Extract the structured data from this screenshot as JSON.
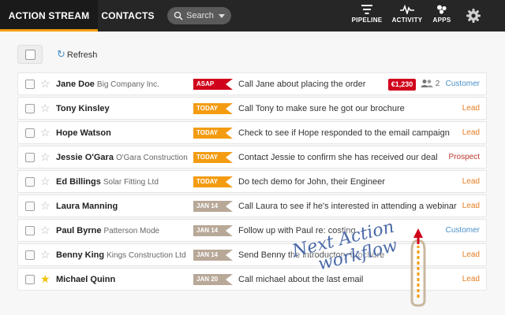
{
  "nav": {
    "tabs": [
      {
        "label": "ACTION STREAM",
        "active": true
      },
      {
        "label": "CONTACTS",
        "active": false
      }
    ],
    "search_placeholder": "Search",
    "buttons": [
      {
        "label": "PIPELINE",
        "icon": "pipeline-icon"
      },
      {
        "label": "ACTIVITY",
        "icon": "activity-icon"
      },
      {
        "label": "APPS",
        "icon": "apps-icon"
      }
    ],
    "settings_icon": "gear-icon"
  },
  "toolbar": {
    "refresh_label": "Refresh"
  },
  "colors": {
    "accent": "#f39c12",
    "asap": "#d0021b",
    "date_tag": "#b8a898",
    "customer": "#4a90c8",
    "lead": "#e67e22",
    "prospect": "#c0392b"
  },
  "rows": [
    {
      "name": "Jane Doe",
      "company": "Big Company Inc.",
      "tag": "ASAP",
      "tag_type": "asap",
      "task": "Call Jane about placing the order",
      "amount": "€1,230",
      "people": "2",
      "status": "Customer",
      "status_type": "customer",
      "starred": false
    },
    {
      "name": "Tony Kinsley",
      "company": "",
      "tag": "TODAY",
      "tag_type": "today",
      "task": "Call Tony to make sure he got our brochure",
      "status": "Lead",
      "status_type": "lead",
      "starred": false
    },
    {
      "name": "Hope Watson",
      "company": "",
      "tag": "TODAY",
      "tag_type": "today",
      "task": "Check to see if Hope responded to the email campaign",
      "status": "Lead",
      "status_type": "lead",
      "starred": false
    },
    {
      "name": "Jessie O'Gara",
      "company": "O'Gara Construction",
      "tag": "TODAY",
      "tag_type": "today",
      "task": "Contact Jessie to confirm she has received our deal",
      "status": "Prospect",
      "status_type": "prospect",
      "starred": false
    },
    {
      "name": "Ed Billings",
      "company": "Solar Fitting Ltd",
      "tag": "TODAY",
      "tag_type": "today",
      "task": "Do tech demo for John, their Engineer",
      "status": "Lead",
      "status_type": "lead",
      "starred": false
    },
    {
      "name": "Laura Manning",
      "company": "",
      "tag": "JAN 14",
      "tag_type": "date",
      "task": "Call Laura to see if he's interested in attending a webinar",
      "status": "Lead",
      "status_type": "lead",
      "starred": false
    },
    {
      "name": "Paul Byrne",
      "company": "Patterson Mode",
      "tag": "JAN 14",
      "tag_type": "date",
      "task": "Follow up with Paul re: costing",
      "status": "Customer",
      "status_type": "customer",
      "starred": false
    },
    {
      "name": "Benny King",
      "company": "Kings Construction Ltd",
      "tag": "JAN 14",
      "tag_type": "date",
      "task": "Send Benny the introductory brochure",
      "status": "Lead",
      "status_type": "lead",
      "starred": false
    },
    {
      "name": "Michael Quinn",
      "company": "",
      "tag": "JAN 20",
      "tag_type": "date",
      "task": "Call michael about the last email",
      "status": "Lead",
      "status_type": "lead",
      "starred": true
    }
  ],
  "annotation": {
    "line1": "Next Action",
    "line2": "workflow"
  }
}
